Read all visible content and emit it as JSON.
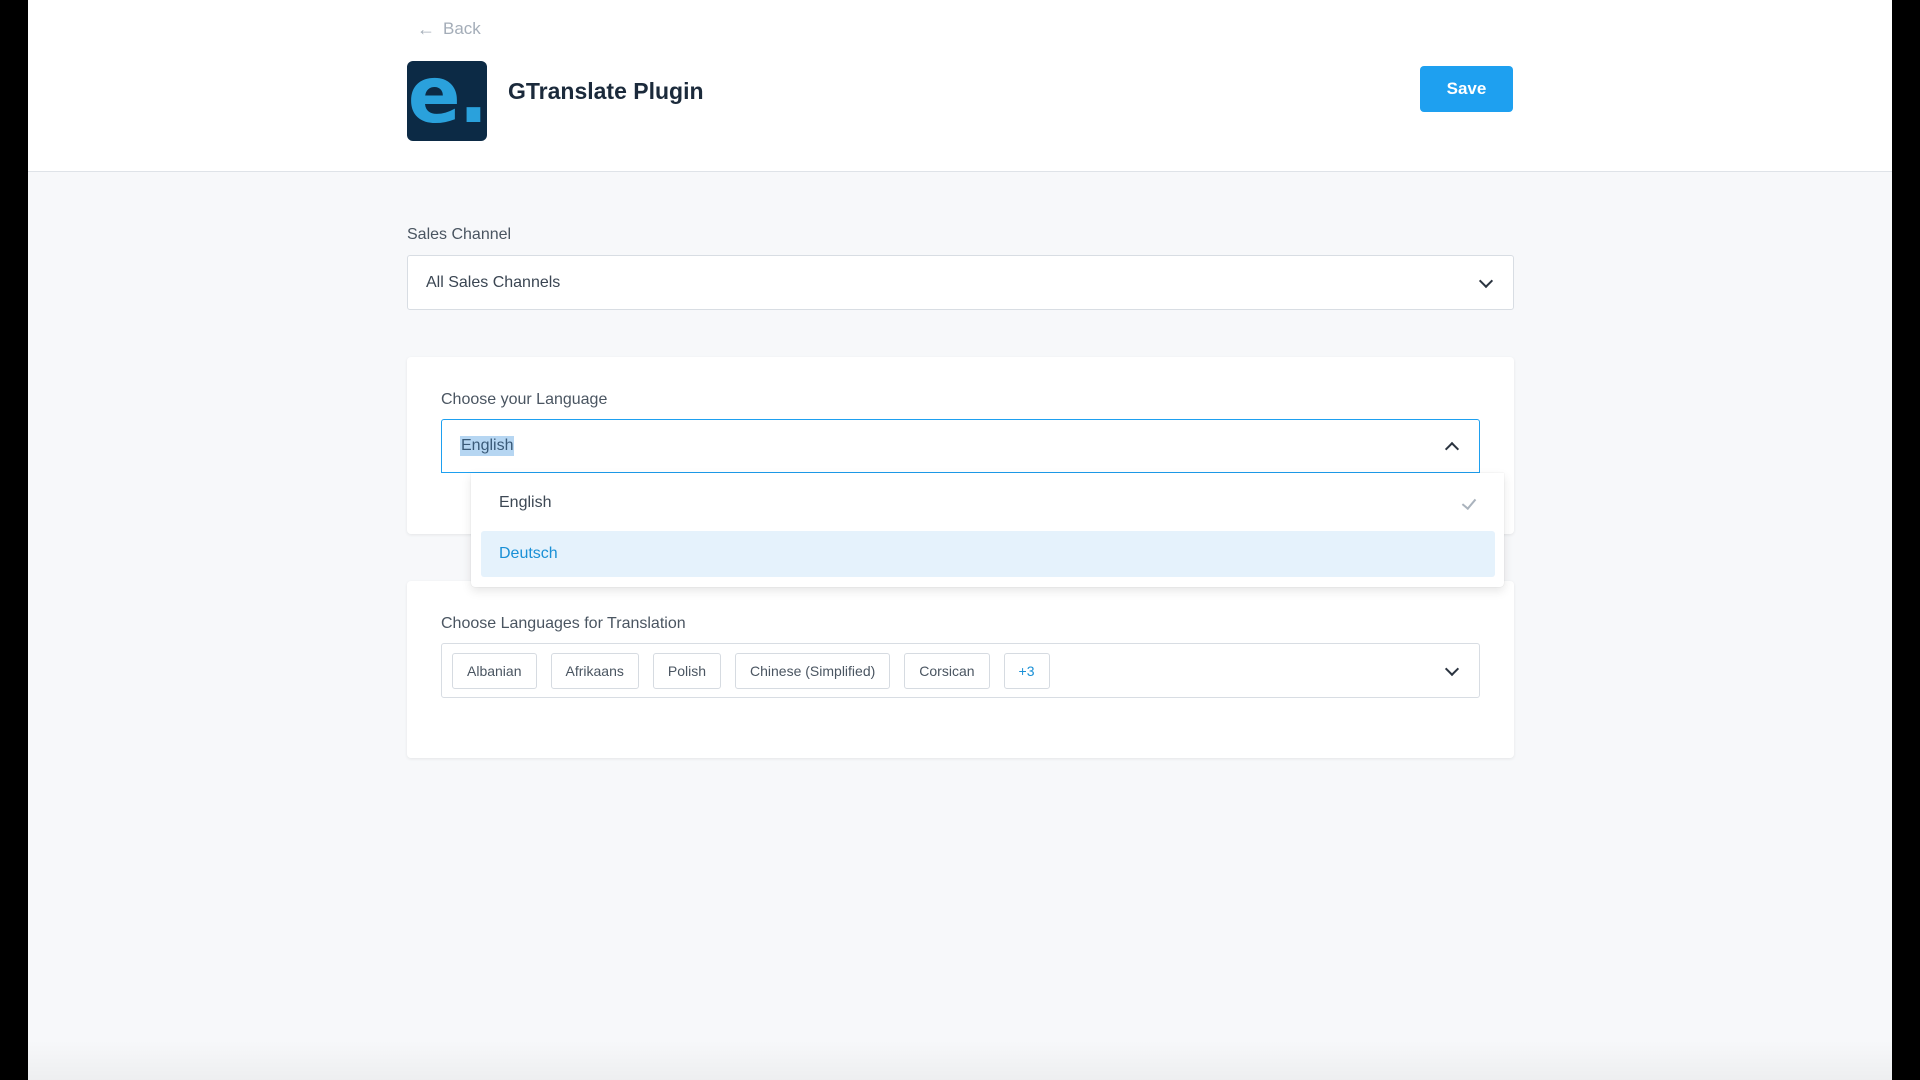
{
  "header": {
    "back_label": "Back",
    "logo_text": "e.",
    "title": "GTranslate Plugin",
    "save_label": "Save"
  },
  "sales_channel": {
    "label": "Sales Channel",
    "value": "All Sales Channels"
  },
  "language": {
    "label": "Choose your Language",
    "value": "English",
    "options": [
      {
        "label": "English",
        "selected": true
      },
      {
        "label": "Deutsch",
        "highlighted": true
      }
    ]
  },
  "translation": {
    "label": "Choose Languages for Translation",
    "tags": [
      "Albanian",
      "Afrikaans",
      "Polish",
      "Chinese (Simplified)",
      "Corsican"
    ],
    "more_label": "+3"
  },
  "colors": {
    "accent": "#1ea0f0",
    "logo_bg": "#0c2a45",
    "logo_mark": "#2aa1dc",
    "highlight_bg": "#e5f2fc"
  }
}
